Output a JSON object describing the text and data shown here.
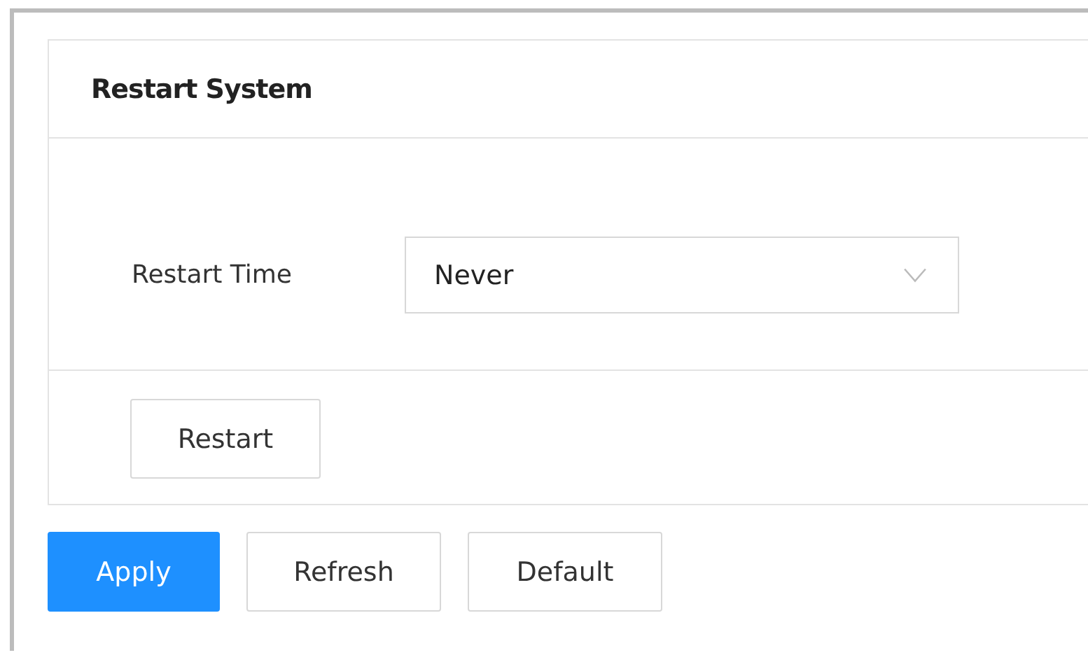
{
  "panel": {
    "title": "Restart System",
    "restart_time": {
      "label": "Restart Time",
      "value": "Never"
    },
    "restart_button": "Restart"
  },
  "buttons": [
    {
      "label": "Apply",
      "kind": "primary"
    },
    {
      "label": "Refresh",
      "kind": "default"
    },
    {
      "label": "Default",
      "kind": "default"
    }
  ]
}
